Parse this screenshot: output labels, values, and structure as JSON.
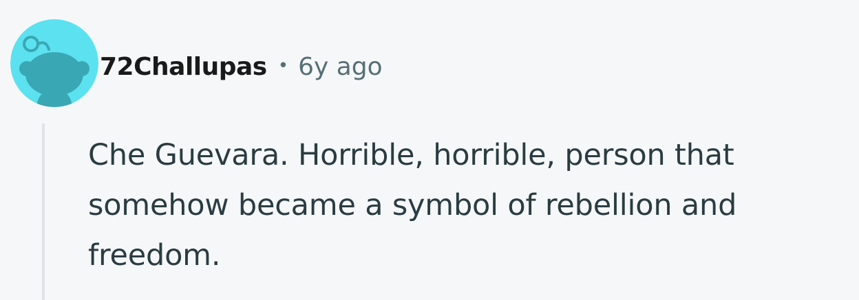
{
  "comment": {
    "author": "72Challupas",
    "separator": "•",
    "timestamp": "6y ago",
    "body": "Che Guevara. Horrible, horrible, person that somehow became a symbol of rebellion and freedom.",
    "avatar_icon": "snoo-avatar-icon"
  },
  "colors": {
    "background": "#f6f7f8",
    "avatar_bg": "#5ce1f0",
    "avatar_snoo": "#3aa7b5",
    "username": "#1a1a1b",
    "meta": "#576f76",
    "body_text": "#2a3c42",
    "thread_line": "#dfe3e6"
  }
}
